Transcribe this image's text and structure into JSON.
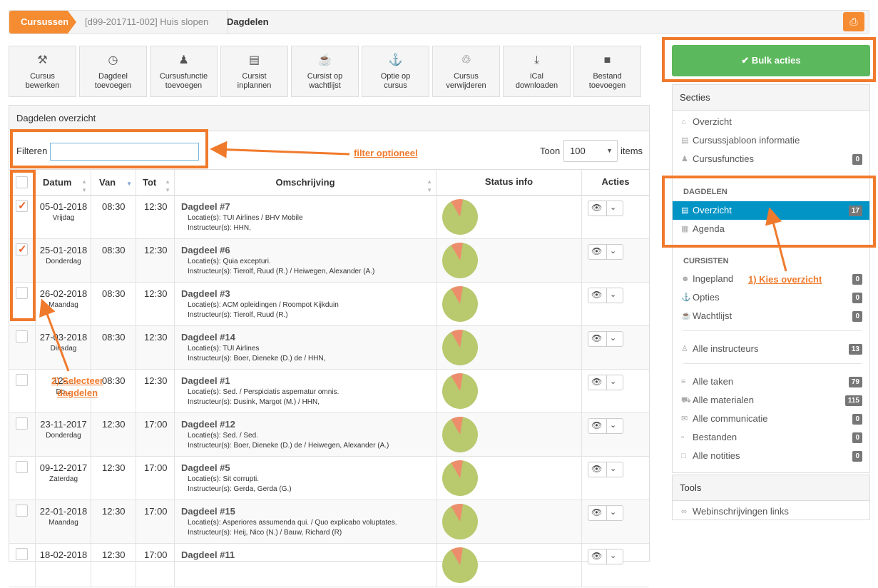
{
  "breadcrumb": {
    "item1": "Cursussen",
    "item2": "[d99-201711-002] Huis slopen",
    "item3": "Dagdelen"
  },
  "toolbar": [
    {
      "label1": "Cursus",
      "label2": "bewerken",
      "icon": "wrench-icon",
      "glyph": "⚒"
    },
    {
      "label1": "Dagdeel",
      "label2": "toevoegen",
      "icon": "clock-icon",
      "glyph": "◷"
    },
    {
      "label1": "Cursusfunctie",
      "label2": "toevoegen",
      "icon": "user-secret-icon",
      "glyph": "♟"
    },
    {
      "label1": "Cursist",
      "label2": "inplannen",
      "icon": "id-card-icon",
      "glyph": "▤"
    },
    {
      "label1": "Cursist op",
      "label2": "wachtlijst",
      "icon": "coffee-icon",
      "glyph": "☕"
    },
    {
      "label1": "Optie op",
      "label2": "cursus",
      "icon": "pin-icon",
      "glyph": "⚓"
    },
    {
      "label1": "Cursus",
      "label2": "verwijderen",
      "icon": "trash-icon",
      "glyph": "♲"
    },
    {
      "label1": "iCal",
      "label2": "downloaden",
      "icon": "download-icon",
      "glyph": "⤓"
    },
    {
      "label1": "Bestand",
      "label2": "toevoegen",
      "icon": "file-icon",
      "glyph": "■"
    }
  ],
  "panel": {
    "title": "Dagdelen overzicht",
    "filter_label": "Filteren",
    "filter_value": "",
    "toon": "Toon",
    "toon_value": "100",
    "items": "items"
  },
  "columns": {
    "datum": "Datum",
    "van": "Van",
    "tot": "Tot",
    "omschrijving": "Omschrijving",
    "status": "Status info",
    "acties": "Acties"
  },
  "rows": [
    {
      "checked": true,
      "date": "05-01-2018",
      "day": "Vrijdag",
      "van": "08:30",
      "tot": "12:30",
      "title": "Dagdeel #7",
      "loc": "Locatie(s): TUI Airlines / BHV Mobile",
      "ins": "Instructeur(s): HHN,"
    },
    {
      "checked": true,
      "date": "25-01-2018",
      "day": "Donderdag",
      "van": "08:30",
      "tot": "12:30",
      "title": "Dagdeel #6",
      "loc": "Locatie(s): Quia excepturi.",
      "ins": "Instructeur(s): Tierolf, Ruud (R.) / Heiwegen, Alexander (A.)"
    },
    {
      "checked": false,
      "date": "26-02-2018",
      "day": "Maandag",
      "van": "08:30",
      "tot": "12:30",
      "title": "Dagdeel #3",
      "loc": "Locatie(s): ACM opleidingen / Roompot Kijkduin",
      "ins": "Instructeur(s): Tierolf, Ruud (R.)"
    },
    {
      "checked": false,
      "date": "27-03-2018",
      "day": "Dinsdag",
      "van": "08:30",
      "tot": "12:30",
      "title": "Dagdeel #14",
      "loc": "Locatie(s): TUI Airlines",
      "ins": "Instructeur(s): Boer, Dieneke (D.) de / HHN,"
    },
    {
      "checked": false,
      "date": "12-...",
      "day": "Do...",
      "van": "08:30",
      "tot": "12:30",
      "title": "Dagdeel #1",
      "loc": "Locatie(s): Sed. / Perspiciatis aspernatur omnis.",
      "ins": "Instructeur(s): Dusink, Margot (M.) / HHN,"
    },
    {
      "checked": false,
      "date": "23-11-2017",
      "day": "Donderdag",
      "van": "12:30",
      "tot": "17:00",
      "title": "Dagdeel #12",
      "loc": "Locatie(s): Sed. / Sed.",
      "ins": "Instructeur(s): Boer, Dieneke (D.) de / Heiwegen, Alexander (A.)"
    },
    {
      "checked": false,
      "date": "09-12-2017",
      "day": "Zaterdag",
      "van": "12:30",
      "tot": "17:00",
      "title": "Dagdeel #5",
      "loc": "Locatie(s): Sit corrupti.",
      "ins": "Instructeur(s): Gerda, Gerda (G.)"
    },
    {
      "checked": false,
      "date": "22-01-2018",
      "day": "Maandag",
      "van": "12:30",
      "tot": "17:00",
      "title": "Dagdeel #15",
      "loc": "Locatie(s): Asperiores assumenda qui. / Quo explicabo voluptates.",
      "ins": "Instructeur(s): Heij, Nico (N.) / Bauw, Richard (R)"
    },
    {
      "checked": false,
      "date": "18-02-2018",
      "day": "",
      "van": "12:30",
      "tot": "17:00",
      "title": "Dagdeel #11",
      "loc": "",
      "ins": ""
    }
  ],
  "bulk": "✔ Bulk acties",
  "secties": {
    "title": "Secties",
    "items": [
      {
        "label": "Overzicht",
        "badge": ""
      },
      {
        "label": "Cursussjabloon informatie",
        "badge": ""
      },
      {
        "label": "Cursusfuncties",
        "badge": "0"
      }
    ]
  },
  "dagdelen": {
    "title": "DAGDELEN",
    "items": [
      {
        "label": "Overzicht",
        "badge": "17"
      },
      {
        "label": "Agenda",
        "badge": ""
      }
    ]
  },
  "cursisten": {
    "title": "CURSISTEN",
    "items": [
      {
        "label": "Ingepland",
        "badge": "0"
      },
      {
        "label": "Opties",
        "badge": "0"
      },
      {
        "label": "Wachtlijst",
        "badge": "0"
      }
    ]
  },
  "alle": [
    {
      "label": "Alle instructeurs",
      "badge": "13"
    },
    {
      "label": "Alle taken",
      "badge": "79"
    },
    {
      "label": "Alle materialen",
      "badge": "115"
    },
    {
      "label": "Alle communicatie",
      "badge": "0"
    },
    {
      "label": "Bestanden",
      "badge": "0"
    },
    {
      "label": "Alle notities",
      "badge": "0"
    }
  ],
  "tools": {
    "title": "Tools",
    "item": "Webinschrijvingen links"
  },
  "annotations": {
    "filter": "filter optioneel",
    "kies": "1) Kies overzicht",
    "select1": "2) Selecteer",
    "select2": "dagdelen"
  },
  "colors": {
    "orange": "#f68c32",
    "annotation": "#f07a2c",
    "green": "#5cb85c",
    "active": "#0394c6"
  }
}
